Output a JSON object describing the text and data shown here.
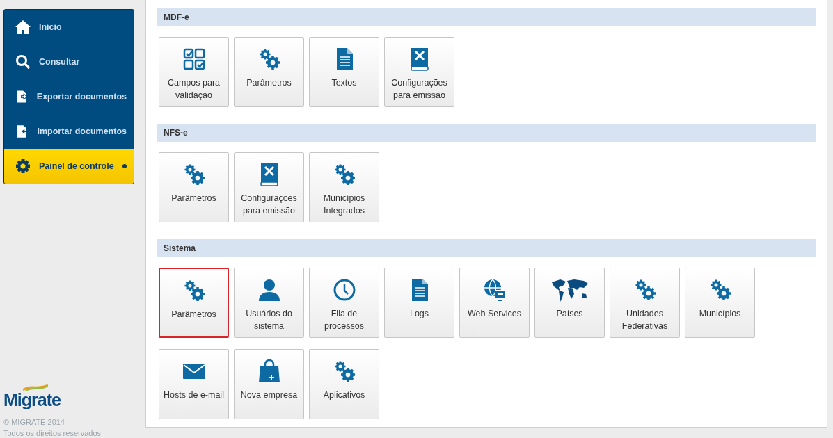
{
  "sidebar": {
    "items": [
      {
        "label": "Início",
        "kind": "home",
        "selected": false
      },
      {
        "label": "Consultar",
        "kind": "search",
        "selected": false
      },
      {
        "label": "Exportar documentos",
        "kind": "export",
        "selected": false
      },
      {
        "label": "Importar documentos",
        "kind": "import",
        "selected": false
      },
      {
        "label": "Painel de controle",
        "kind": "gear",
        "selected": true
      }
    ]
  },
  "footer": {
    "logo": "Migrate",
    "copyright": "© MIGRATE 2014",
    "rights": "Todos os direitos reservados"
  },
  "sections": [
    {
      "title": "MDF-e",
      "tiles": [
        {
          "label": "Campos para validação",
          "kind": "checklist",
          "selected": false
        },
        {
          "label": "Parâmetros",
          "kind": "gears",
          "selected": false
        },
        {
          "label": "Textos",
          "kind": "document",
          "selected": false
        },
        {
          "label": "Configurações para emissão",
          "kind": "manual",
          "selected": false
        }
      ]
    },
    {
      "title": "NFS-e",
      "tiles": [
        {
          "label": "Parâmetros",
          "kind": "gears",
          "selected": false
        },
        {
          "label": "Configurações para emissão",
          "kind": "manual",
          "selected": false
        },
        {
          "label": "Municípios Integrados",
          "kind": "gears",
          "selected": false
        }
      ]
    },
    {
      "title": "Sistema",
      "tiles": [
        {
          "label": "Parâmetros",
          "kind": "gears",
          "selected": true
        },
        {
          "label": "Usuários do sistema",
          "kind": "user",
          "selected": false
        },
        {
          "label": "Fila de processos",
          "kind": "clock",
          "selected": false
        },
        {
          "label": "Logs",
          "kind": "document",
          "selected": false
        },
        {
          "label": "Web Services",
          "kind": "globe",
          "selected": false
        },
        {
          "label": "Países",
          "kind": "map",
          "selected": false
        },
        {
          "label": "Unidades Federativas",
          "kind": "gears",
          "selected": false
        },
        {
          "label": "Municípios",
          "kind": "gears",
          "selected": false
        },
        {
          "label": "Hosts de e-mail",
          "kind": "mail",
          "selected": false
        },
        {
          "label": "Nova empresa",
          "kind": "bag",
          "selected": false
        },
        {
          "label": "Aplicativos",
          "kind": "gears",
          "selected": false
        }
      ]
    }
  ]
}
